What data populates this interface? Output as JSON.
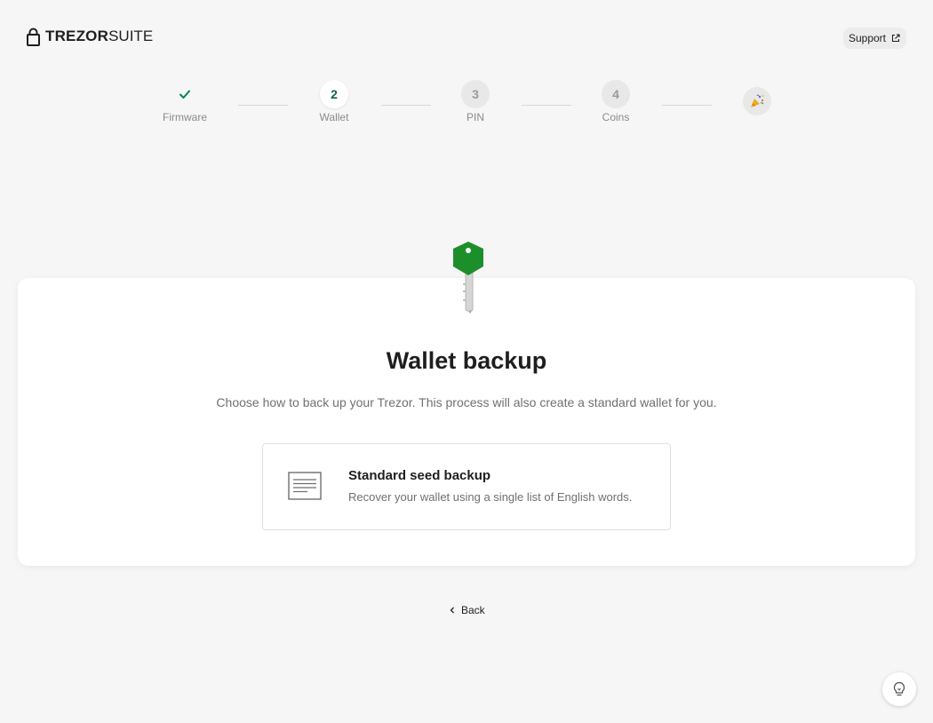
{
  "header": {
    "logo_bold": "TREZOR",
    "logo_light": "SUITE",
    "support_label": "Support"
  },
  "stepper": {
    "steps": [
      {
        "number": "",
        "label": "Firmware",
        "state": "done"
      },
      {
        "number": "2",
        "label": "Wallet",
        "state": "active"
      },
      {
        "number": "3",
        "label": "PIN",
        "state": "todo"
      },
      {
        "number": "4",
        "label": "Coins",
        "state": "todo"
      }
    ],
    "final_icon": "party-popper-icon"
  },
  "card": {
    "title": "Wallet backup",
    "subtitle": "Choose how to back up your Trezor. This process will also create a standard wallet for you.",
    "option": {
      "title": "Standard seed backup",
      "description": "Recover your wallet using a single list of English words.",
      "icon": "document-list-icon"
    }
  },
  "footer": {
    "back_label": "Back",
    "tips_icon": "lightbulb-icon"
  },
  "colors": {
    "accent": "#0f6148",
    "check": "#00854d",
    "key_green": "#1d8f2a",
    "background": "#f6f6f6"
  }
}
